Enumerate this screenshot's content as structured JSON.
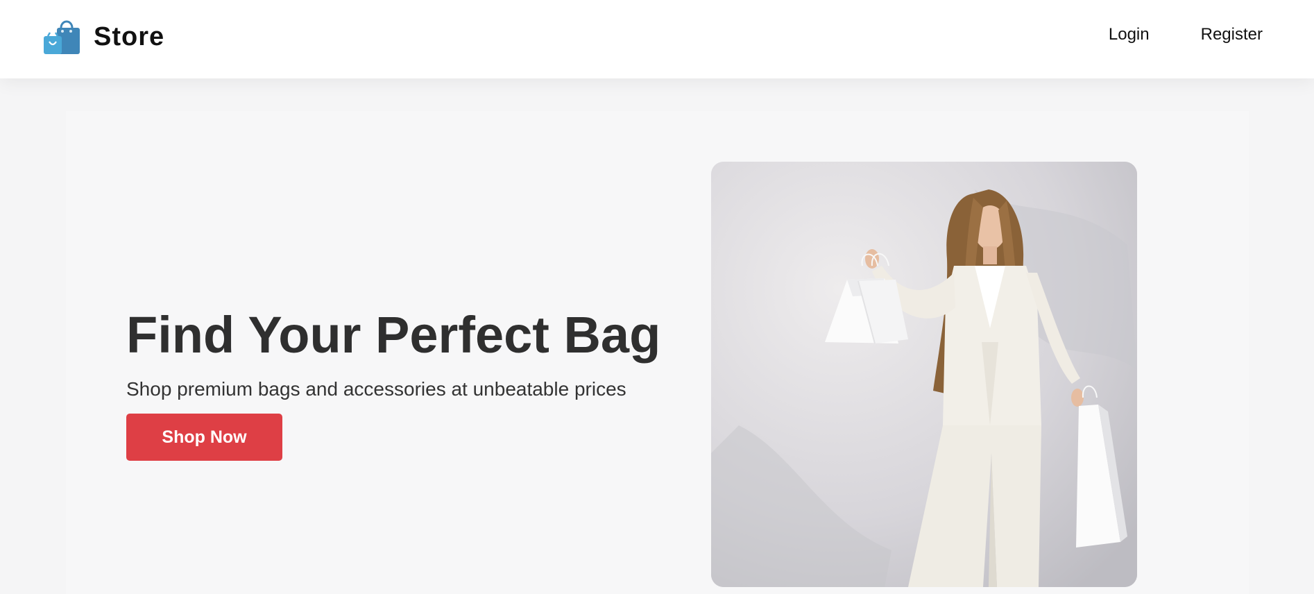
{
  "header": {
    "brand": {
      "name": "Store",
      "logo_icon": "shopping-bags-icon",
      "logo_colors": [
        "#4aa8d8",
        "#3f86b8"
      ]
    },
    "nav": {
      "login_label": "Login",
      "register_label": "Register"
    }
  },
  "hero": {
    "title": "Find Your Perfect Bag",
    "subtitle": "Shop premium bags and accessories at unbeatable prices",
    "cta_label": "Shop Now",
    "cta_color": "#de3f45",
    "image": {
      "subject": "woman-in-white-suit-holding-shopping-bags"
    }
  }
}
